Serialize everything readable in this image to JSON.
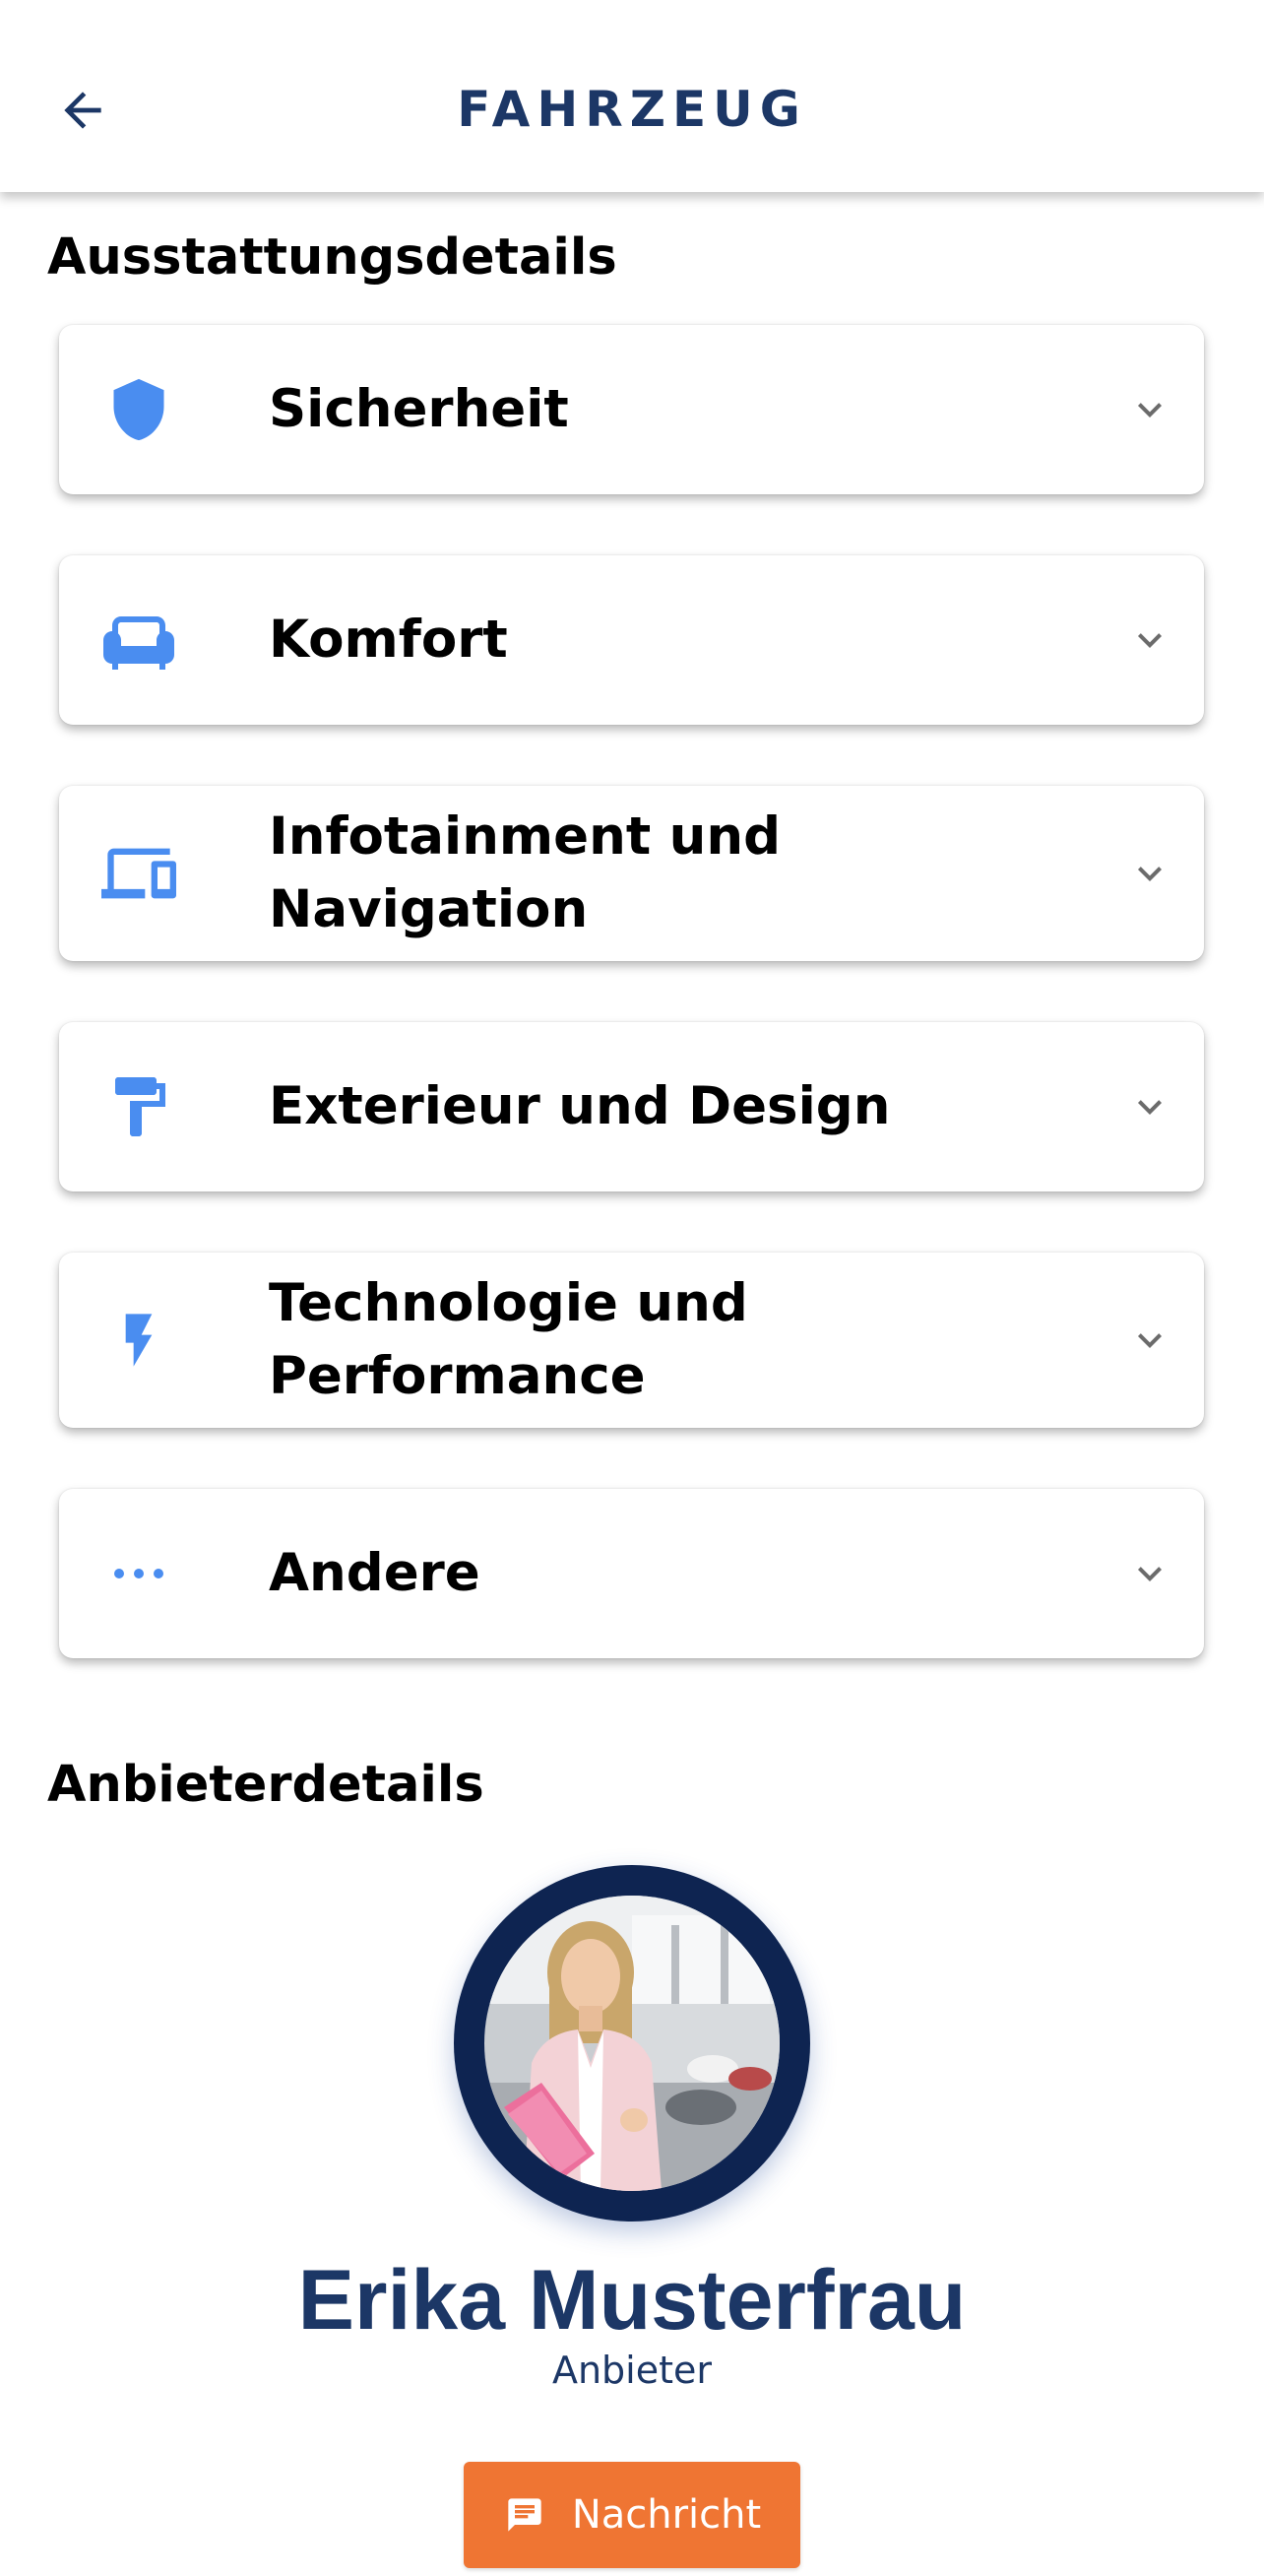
{
  "header": {
    "title": "FAHRZEUG",
    "back_icon": "arrow-left-icon"
  },
  "equipment": {
    "heading": "Ausstattungsdetails",
    "items": [
      {
        "label": "Sicherheit",
        "icon": "shield-icon"
      },
      {
        "label": "Komfort",
        "icon": "armchair-icon"
      },
      {
        "label": "Infotainment und Navigation",
        "icon": "devices-icon"
      },
      {
        "label": "Exterieur und Design",
        "icon": "paint-roller-icon"
      },
      {
        "label": "Technologie und Performance",
        "icon": "lightning-bolt-icon"
      },
      {
        "label": "Andere",
        "icon": "more-dots-icon"
      }
    ]
  },
  "vendor": {
    "heading": "Anbieterdetails",
    "name": "Erika Musterfrau",
    "role": "Anbieter",
    "message_button": "Nachricht"
  },
  "colors": {
    "primary_text": "#1c3766",
    "icon_blue": "#4a8df0",
    "accent_orange": "#ef7533",
    "avatar_ring": "#0e2451"
  }
}
